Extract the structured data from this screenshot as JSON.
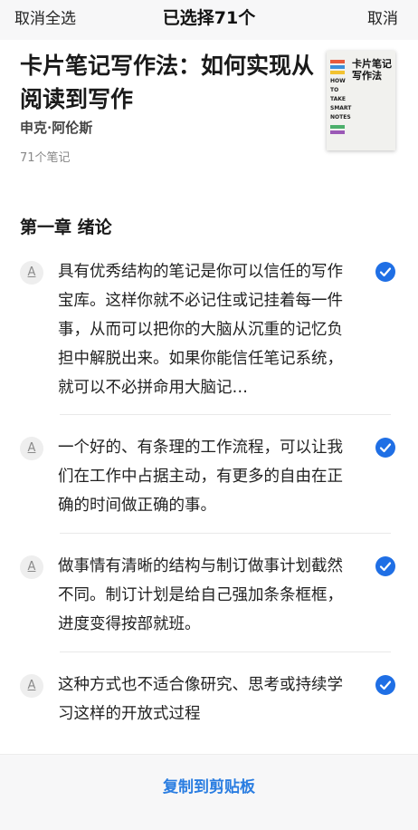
{
  "topbar": {
    "left_action": "取消全选",
    "title": "已选择71个",
    "right_action": "取消"
  },
  "book": {
    "title": "卡片笔记写作法：如何实现从阅读到写作",
    "author": "申克·阿伦斯",
    "note_count": "71个笔记",
    "cover": {
      "title": "卡片笔记写作法",
      "en_words": [
        "HOW",
        "TO",
        "TAKE",
        "SMART",
        "NOTES"
      ]
    }
  },
  "chapter": "第一章 绪论",
  "notes": [
    {
      "icon": "A",
      "text": "具有优秀结构的笔记是你可以信任的写作宝库。这样你就不必记住或记挂着每一件事，从而可以把你的大脑从沉重的记忆负担中解脱出来。如果你能信任笔记系统，就可以不必拼命用大脑记…",
      "selected": true
    },
    {
      "icon": "A",
      "text": "一个好的、有条理的工作流程，可以让我们在工作中占据主动，有更多的自由在正确的时间做正确的事。",
      "selected": true
    },
    {
      "icon": "A",
      "text": "做事情有清晰的结构与制订做事计划截然不同。制订计划是给自己强加条条框框，进度变得按部就班。",
      "selected": true
    },
    {
      "icon": "A",
      "text": "这种方式也不适合像研究、思考或持续学习这样的开放式过程",
      "selected": true
    }
  ],
  "bottom": {
    "copy_label": "复制到剪贴板"
  },
  "colors": {
    "accent": "#1f6fe5",
    "link": "#2a7de1",
    "bar_bg": "#f7f7f8"
  }
}
